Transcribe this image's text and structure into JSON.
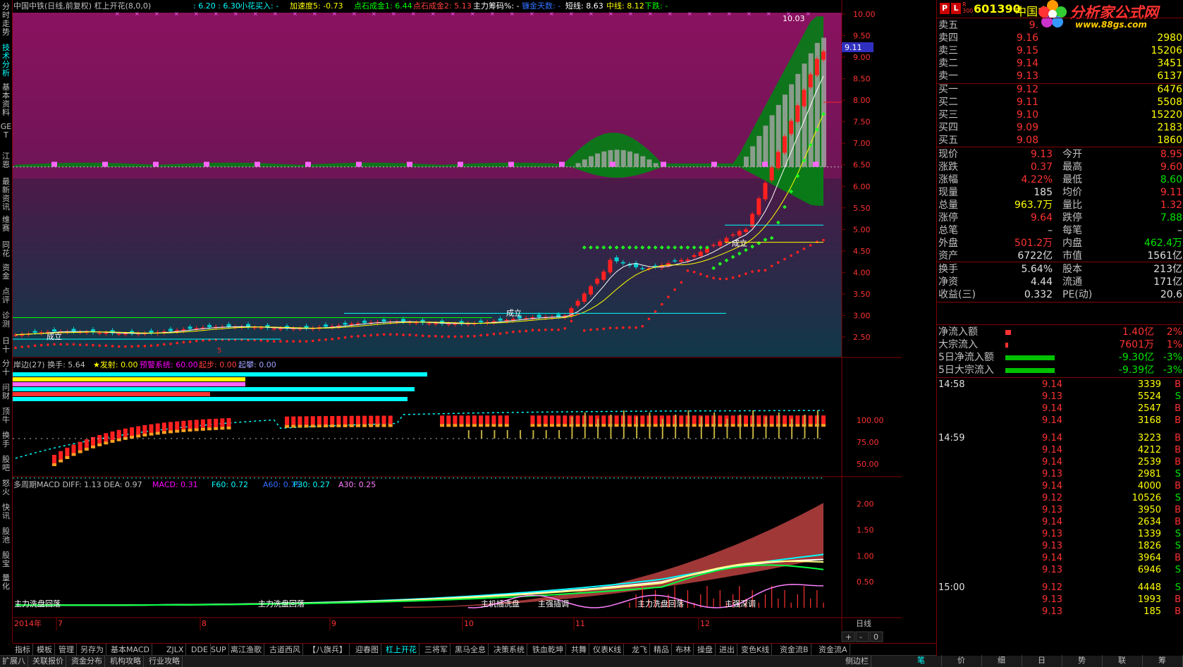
{
  "left_nav": [
    {
      "label": "分时走势",
      "active": false
    },
    {
      "label": "技术分析",
      "active": true
    },
    {
      "label": "基本资料",
      "active": false
    },
    {
      "label": "GET",
      "active": false
    },
    {
      "label": "江恩",
      "active": false
    },
    {
      "label": "最新资讯",
      "active": false
    },
    {
      "label": "维赛",
      "active": false
    },
    {
      "label": "同花",
      "active": false
    },
    {
      "label": "资金",
      "active": false
    },
    {
      "label": "点评",
      "active": false
    },
    {
      "label": "诊测",
      "active": false
    },
    {
      "label": "日十",
      "active": false
    },
    {
      "label": "分十",
      "active": false
    },
    {
      "label": "问财",
      "active": false
    },
    {
      "label": "顶牛",
      "active": false
    },
    {
      "label": "换手",
      "active": false
    },
    {
      "label": "股吧",
      "active": false
    },
    {
      "label": "怒火",
      "active": false
    },
    {
      "label": "快讯",
      "active": false
    },
    {
      "label": "股池",
      "active": false
    },
    {
      "label": "股宝",
      "active": false
    },
    {
      "label": "量化",
      "active": false
    }
  ],
  "header": {
    "title": "中国中铁(日线,前复权) 杠上开花(8,0,0)",
    "segments": [
      {
        "text": ": 6.20 : 6.30",
        "color": "#00ffff"
      },
      {
        "text": "小花买入: -",
        "color": "#00ffff"
      },
      {
        "text": "加速度5: -0.73",
        "color": "#ffff00"
      },
      {
        "text": "点石成金1: 6.44",
        "color": "#00ff00"
      },
      {
        "text": "点石成金2: 5.13",
        "color": "#ff4040"
      },
      {
        "text": "主力筹码%: -",
        "color": "#ffffff"
      },
      {
        "text": "镰金天数: -",
        "color": "#3070ff"
      },
      {
        "text": "短线: 8.63",
        "color": "#ffffff"
      },
      {
        "text": "中线: 8.12",
        "color": "#ffff00"
      },
      {
        "text": "下跌: -",
        "color": "#00ff00"
      }
    ]
  },
  "main_chart": {
    "price_ticks": [
      "10.00",
      "9.50",
      "9.00",
      "8.50",
      "8.00",
      "7.50",
      "7.00",
      "6.50",
      "6.00",
      "5.50",
      "5.00",
      "4.50",
      "4.00",
      "3.50",
      "3.00",
      "2.50"
    ],
    "price_tick_values": [
      10.0,
      9.5,
      9.0,
      8.5,
      8.0,
      7.5,
      7.0,
      6.5,
      6.0,
      5.5,
      5.0,
      4.5,
      4.0,
      3.5,
      3.0,
      2.5
    ],
    "high_label": "10.03",
    "current_price_label": "9.11",
    "annotations": [
      "成立",
      "成立",
      "成立"
    ],
    "marker_5": "5"
  },
  "panel2": {
    "title": "岸边(27) 换手: 5.64",
    "segments": [
      {
        "text": "★发射: 0.00",
        "color": "#ffff00"
      },
      {
        "text": "预警系统: 60.00",
        "color": "#ff00ff"
      },
      {
        "text": "起步: 0.00",
        "color": "#ff4040"
      },
      {
        "text": "起攀: 0.00",
        "color": "#a0a0ff"
      }
    ],
    "ticks": [
      "100.00",
      "75.00",
      "50.00"
    ],
    "tick_values": [
      100,
      75,
      50
    ]
  },
  "panel3": {
    "title": "多周期MACD DIFF: 1.13 DEA: 0.97",
    "segments": [
      {
        "text": "MACD: 0.31",
        "color": "#ff00ff"
      },
      {
        "text": "F60: 0.72",
        "color": "#00ffff"
      },
      {
        "text": "A60: 0.75",
        "color": "#3070ff"
      },
      {
        "text": "F30: 0.27",
        "color": "#00ffff"
      },
      {
        "text": "A30: 0.25",
        "color": "#ff80ff"
      }
    ],
    "ticks": [
      "2.00",
      "1.50",
      "1.00",
      "0.50"
    ],
    "tick_values": [
      2.0,
      1.5,
      1.0,
      0.5
    ],
    "bottom_labels": [
      "主力洗盘回落",
      "主力洗盘回落",
      "主机插洗盘",
      "主强插调",
      "主力洗盘回落",
      "主强深调"
    ]
  },
  "x_axis": {
    "labels": [
      "2014年",
      "7",
      "8",
      "9",
      "10",
      "11",
      "12"
    ],
    "period": "日线",
    "buttons": [
      "+",
      "-",
      "0"
    ]
  },
  "right_panel": {
    "code": "601390",
    "name": "中国中",
    "badge_top": "R",
    "badge_bottom": "300",
    "logo_name": "分析家公式网",
    "logo_url": "www.88gs.com",
    "asks": [
      {
        "label": "卖五",
        "price": "9.",
        "vol": ""
      },
      {
        "label": "卖四",
        "price": "9.16",
        "vol": "2980"
      },
      {
        "label": "卖三",
        "price": "9.15",
        "vol": "15206"
      },
      {
        "label": "卖二",
        "price": "9.14",
        "vol": "3451"
      },
      {
        "label": "卖一",
        "price": "9.13",
        "vol": "6137"
      }
    ],
    "bids": [
      {
        "label": "买一",
        "price": "9.12",
        "vol": "6476"
      },
      {
        "label": "买二",
        "price": "9.11",
        "vol": "5508"
      },
      {
        "label": "买三",
        "price": "9.10",
        "vol": "15220"
      },
      {
        "label": "买四",
        "price": "9.09",
        "vol": "2183"
      },
      {
        "label": "买五",
        "price": "9.08",
        "vol": "1860"
      }
    ],
    "quote": [
      {
        "l1": "现价",
        "v1": "9.13",
        "c1": "up",
        "l2": "今开",
        "v2": "8.95",
        "c2": "up"
      },
      {
        "l1": "涨跌",
        "v1": "0.37",
        "c1": "up",
        "l2": "最高",
        "v2": "9.60",
        "c2": "up"
      },
      {
        "l1": "涨幅",
        "v1": "4.22%",
        "c1": "up",
        "l2": "最低",
        "v2": "8.60",
        "c2": "dn"
      },
      {
        "l1": "现量",
        "v1": "185",
        "c1": "wht",
        "l2": "均价",
        "v2": "9.11",
        "c2": "up"
      },
      {
        "l1": "总量",
        "v1": "963.7万",
        "c1": "yel",
        "l2": "量比",
        "v2": "1.32",
        "c2": "up"
      },
      {
        "l1": "涨停",
        "v1": "9.64",
        "c1": "up",
        "l2": "跌停",
        "v2": "7.88",
        "c2": "dn"
      },
      {
        "l1": "总笔",
        "v1": "–",
        "c1": "wht",
        "l2": "每笔",
        "v2": "–",
        "c2": "wht"
      },
      {
        "l1": "外盘",
        "v1": "501.2万",
        "c1": "up",
        "l2": "内盘",
        "v2": "462.4万",
        "c2": "dn"
      },
      {
        "l1": "资产",
        "v1": "6722亿",
        "c1": "wht",
        "l2": "市值",
        "v2": "1561亿",
        "c2": "wht"
      }
    ],
    "finance": [
      {
        "l1": "换手",
        "v1": "5.64%",
        "l2": "股本",
        "v2": "213亿"
      },
      {
        "l1": "净资",
        "v1": "4.44",
        "l2": "流通",
        "v2": "171亿"
      },
      {
        "l1": "收益(三)",
        "v1": "0.332",
        "l2": "PE(动)",
        "v2": "20.6"
      }
    ],
    "flows": [
      {
        "label": "净流入额",
        "value": "1.40亿",
        "pct": "2%",
        "color": "up",
        "bar": 0.12
      },
      {
        "label": "大宗流入",
        "value": "7601万",
        "pct": "1%",
        "color": "up",
        "bar": 0.06
      },
      {
        "label": "5日净流入额",
        "value": "-9.30亿",
        "pct": "-3%",
        "color": "dn",
        "bar": 1.0
      },
      {
        "label": "5日大宗流入",
        "value": "-9.39亿",
        "pct": "-3%",
        "color": "dn",
        "bar": 1.0
      }
    ],
    "ticks": [
      {
        "time": "14:58",
        "price": "9.14",
        "vol": "3339",
        "side": "B"
      },
      {
        "time": "",
        "price": "9.13",
        "vol": "5524",
        "side": "S"
      },
      {
        "time": "",
        "price": "9.14",
        "vol": "2547",
        "side": "B"
      },
      {
        "time": "",
        "price": "9.14",
        "vol": "3168",
        "side": "B"
      },
      {
        "time": "14:59",
        "price": "9.14",
        "vol": "3223",
        "side": "B"
      },
      {
        "time": "",
        "price": "9.14",
        "vol": "4212",
        "side": "B"
      },
      {
        "time": "",
        "price": "9.14",
        "vol": "2539",
        "side": "B"
      },
      {
        "time": "",
        "price": "9.13",
        "vol": "2981",
        "side": "S"
      },
      {
        "time": "",
        "price": "9.14",
        "vol": "4000",
        "side": "B"
      },
      {
        "time": "",
        "price": "9.12",
        "vol": "10526",
        "side": "S"
      },
      {
        "time": "",
        "price": "9.13",
        "vol": "3950",
        "side": "B"
      },
      {
        "time": "",
        "price": "9.14",
        "vol": "2634",
        "side": "B"
      },
      {
        "time": "",
        "price": "9.13",
        "vol": "1339",
        "side": "S"
      },
      {
        "time": "",
        "price": "9.13",
        "vol": "1826",
        "side": "S"
      },
      {
        "time": "",
        "price": "9.14",
        "vol": "3964",
        "side": "B"
      },
      {
        "time": "",
        "price": "9.13",
        "vol": "6946",
        "side": "S"
      },
      {
        "time": "15:00",
        "price": "9.12",
        "vol": "4448",
        "side": "S"
      },
      {
        "time": "",
        "price": "9.13",
        "vol": "1993",
        "side": "B"
      },
      {
        "time": "",
        "price": "9.13",
        "vol": "185",
        "side": "B"
      }
    ],
    "bottom_tabs": [
      "笔",
      "价",
      "细",
      "日",
      "势",
      "联",
      "筹"
    ],
    "active_tab": 0
  },
  "indicator_tabs": [
    "指标",
    "模板",
    "管理",
    "另存为",
    "基本MACD",
    "ZJLX",
    "DDE",
    "SUP",
    "离江渔歌",
    "古道西风",
    "【八旗兵】",
    "迎春图",
    "杠上开花",
    "三将军",
    "黑马全息",
    "决策系统",
    "铁血乾坤",
    "共舞",
    "仪表K线",
    "龙飞",
    "精品",
    "布林",
    "操盘",
    "进出",
    "变色K线",
    "资金流B",
    "资金流A"
  ],
  "active_indicator_tab": 12,
  "status_tabs": [
    "扩展八",
    "关联报价",
    "资金分布",
    "机构攻略",
    "行业攻略"
  ],
  "side_panel_label": "侧边栏",
  "colors": {
    "up": "#ff3232",
    "down": "#00e600",
    "border": "#800000",
    "cyan": "#00ffff",
    "yellow": "#ffff00",
    "magenta_bg": "#7a1558"
  }
}
